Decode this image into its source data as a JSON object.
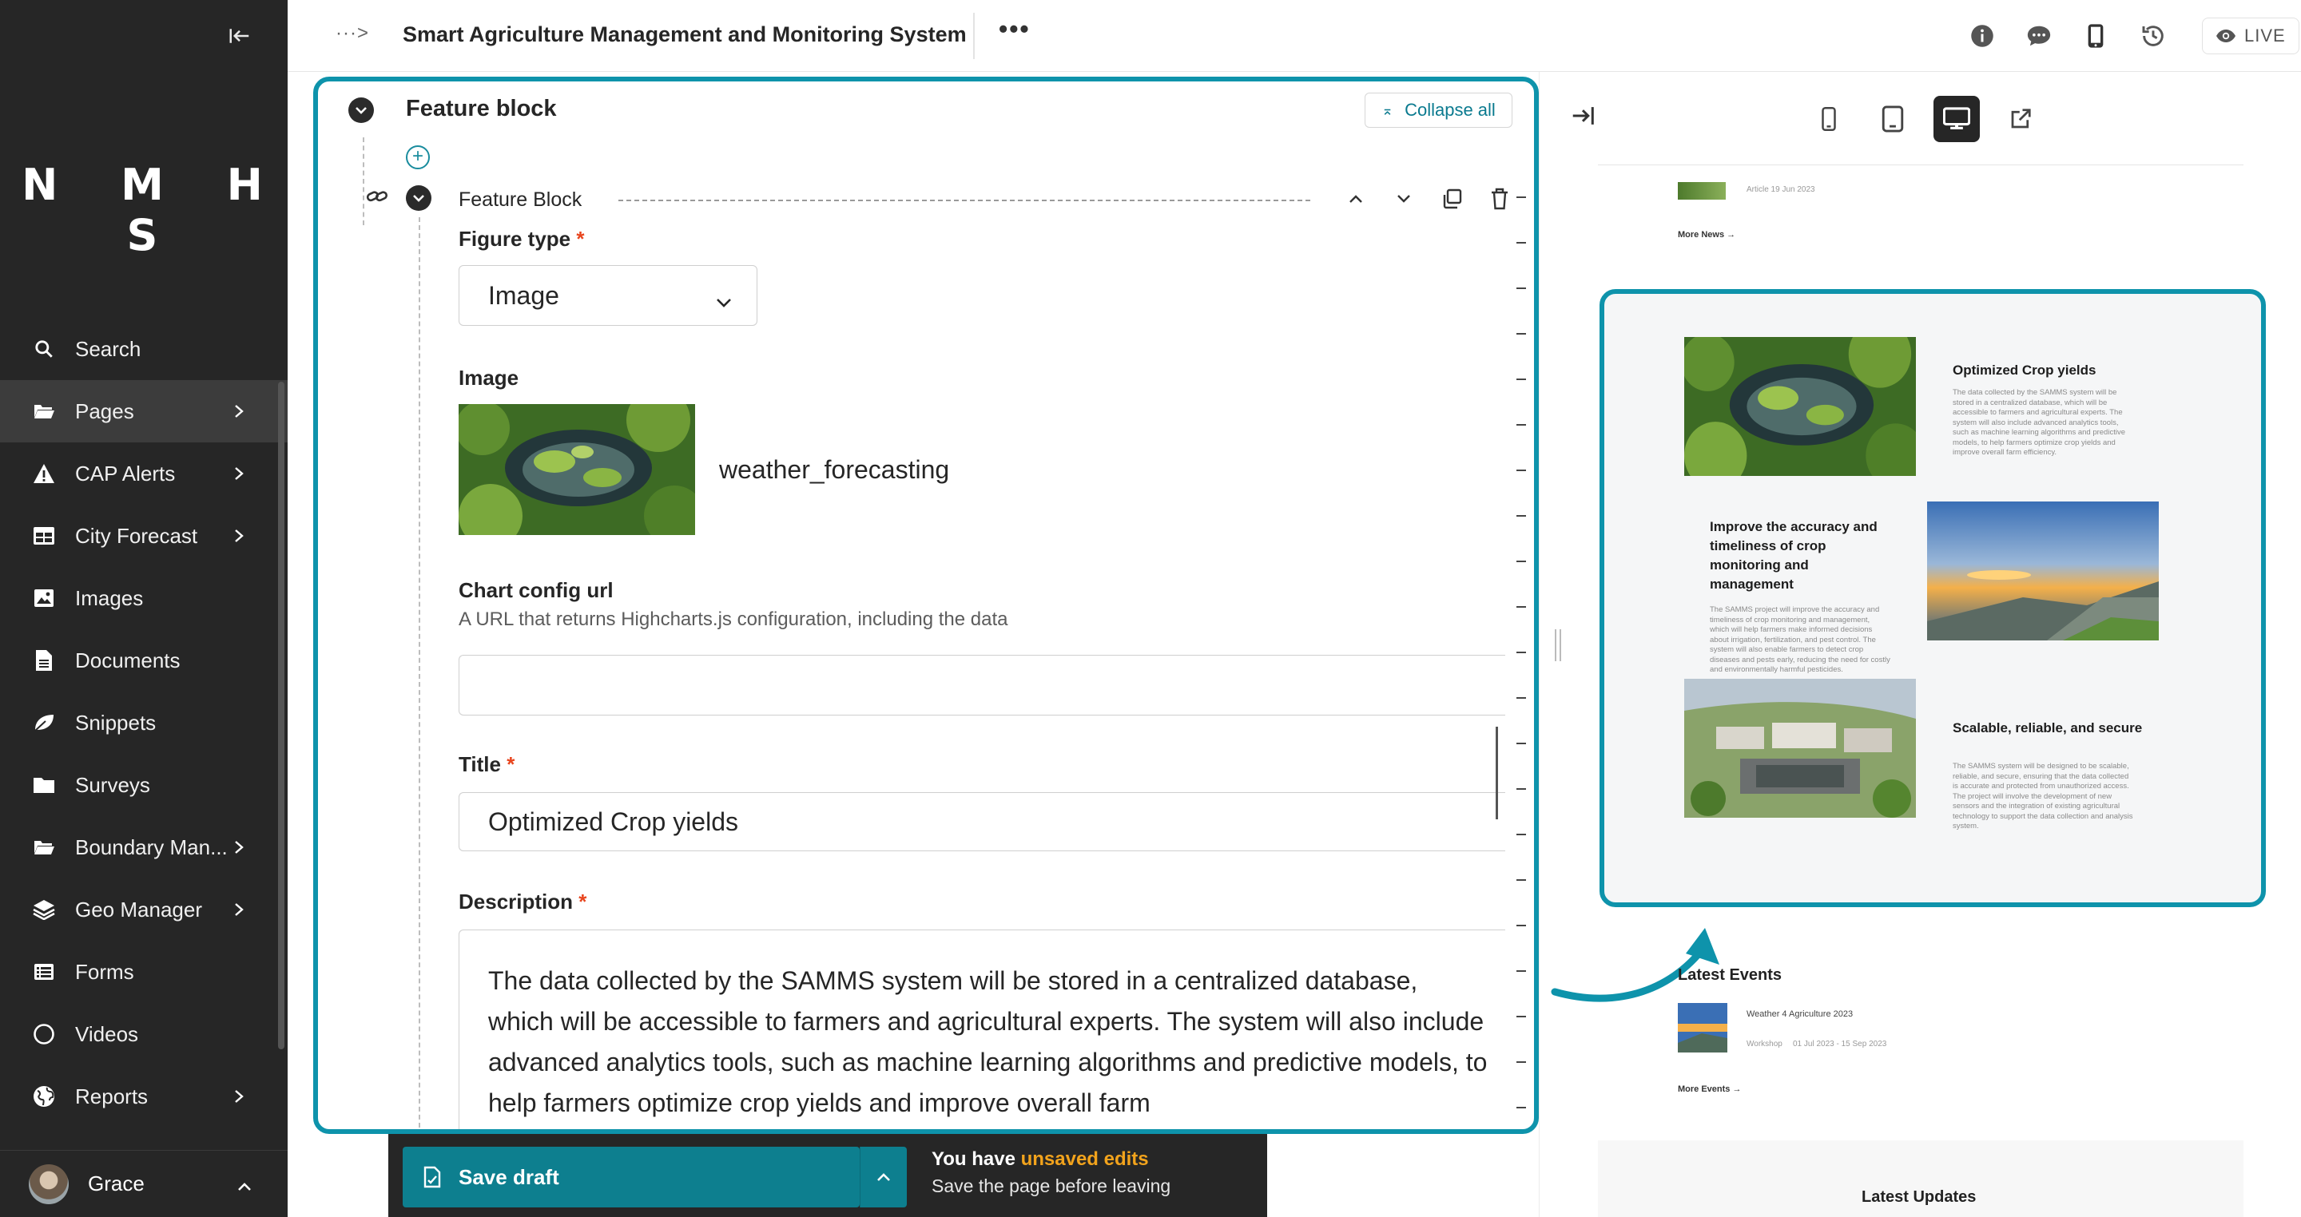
{
  "sidebar": {
    "logo": "N M H S",
    "nav": [
      {
        "label": "Search",
        "icon": "search-icon",
        "has_children": false,
        "active": false
      },
      {
        "label": "Pages",
        "icon": "folder-open-icon",
        "has_children": true,
        "active": true
      },
      {
        "label": "CAP Alerts",
        "icon": "warning-icon",
        "has_children": true,
        "active": false
      },
      {
        "label": "City Forecast",
        "icon": "table-icon",
        "has_children": true,
        "active": false
      },
      {
        "label": "Images",
        "icon": "image-icon",
        "has_children": false,
        "active": false
      },
      {
        "label": "Documents",
        "icon": "document-icon",
        "has_children": false,
        "active": false
      },
      {
        "label": "Snippets",
        "icon": "snippet-icon",
        "has_children": false,
        "active": false
      },
      {
        "label": "Surveys",
        "icon": "folder-icon",
        "has_children": false,
        "active": false
      },
      {
        "label": "Boundary Man...",
        "icon": "folder-open-icon",
        "has_children": true,
        "active": false
      },
      {
        "label": "Geo Manager",
        "icon": "layers-icon",
        "has_children": true,
        "active": false
      },
      {
        "label": "Forms",
        "icon": "list-icon",
        "has_children": false,
        "active": false
      },
      {
        "label": "Videos",
        "icon": "circle-icon",
        "has_children": false,
        "active": false
      },
      {
        "label": "Reports",
        "icon": "globe-icon",
        "has_children": true,
        "active": false
      }
    ],
    "user": {
      "name": "Grace"
    }
  },
  "topbar": {
    "breadcrumb": "···>",
    "title": "Smart Agriculture Management and Monitoring System",
    "more": "•••",
    "live": "LIVE"
  },
  "editor": {
    "block_title": "Feature block",
    "collapse_all": "Collapse all",
    "child_title": "Feature Block",
    "figure_type": {
      "label": "Figure type",
      "value": "Image"
    },
    "image": {
      "label": "Image",
      "name": "weather_forecasting"
    },
    "chart_config": {
      "label": "Chart config url",
      "help": "A URL that returns Highcharts.js configuration, including the data",
      "value": ""
    },
    "title_field": {
      "label": "Title",
      "value": "Optimized Crop yields"
    },
    "description": {
      "label": "Description",
      "value": "The data collected by the SAMMS system will be stored in a centralized database, which will be accessible to farmers and agricultural experts. The system will also include advanced analytics tools, such as machine learning algorithms and predictive models, to help farmers optimize crop yields and improve overall farm"
    },
    "required_mark": "*"
  },
  "savebar": {
    "save_label": "Save draft",
    "msg_prefix": "You have ",
    "msg_highlight": "unsaved edits",
    "msg_line2": "Save the page before leaving"
  },
  "preview": {
    "news_meta": "Article    19 Jun 2023",
    "more_news": "More News →",
    "features": [
      {
        "title": "Optimized Crop yields",
        "desc": "The data collected by the SAMMS system will be stored in a centralized database, which will be accessible to farmers and agricultural experts. The system will also include advanced analytics tools, such as machine learning algorithms and predictive models, to help farmers optimize crop yields and improve overall farm efficiency."
      },
      {
        "title": "Improve the accuracy and timeliness of crop monitoring and management",
        "desc": "The SAMMS project will improve the accuracy and timeliness of crop monitoring and management, which will help farmers make informed decisions about irrigation, fertilization, and pest control. The system will also enable farmers to detect crop diseases and pests early, reducing the need for costly and environmentally harmful pesticides."
      },
      {
        "title": "Scalable, reliable, and secure",
        "desc": "The SAMMS system will be designed to be scalable, reliable, and secure, ensuring that the data collected is accurate and protected from unauthorized access. The project will involve the development of new sensors and the integration of existing agricultural technology to support the data collection and analysis system."
      }
    ],
    "events_title": "Latest Events",
    "event": {
      "name": "Weather 4 Agriculture 2023",
      "type": "Workshop",
      "dates": "01 Jul 2023 - 15 Sep 2023"
    },
    "more_events": "More Events →",
    "updates_title": "Latest Updates"
  },
  "colors": {
    "accent": "#0e93ab",
    "save": "#0d7f8f",
    "sidebar": "#262626",
    "warning": "#f2a31c",
    "required": "#e8451e"
  }
}
